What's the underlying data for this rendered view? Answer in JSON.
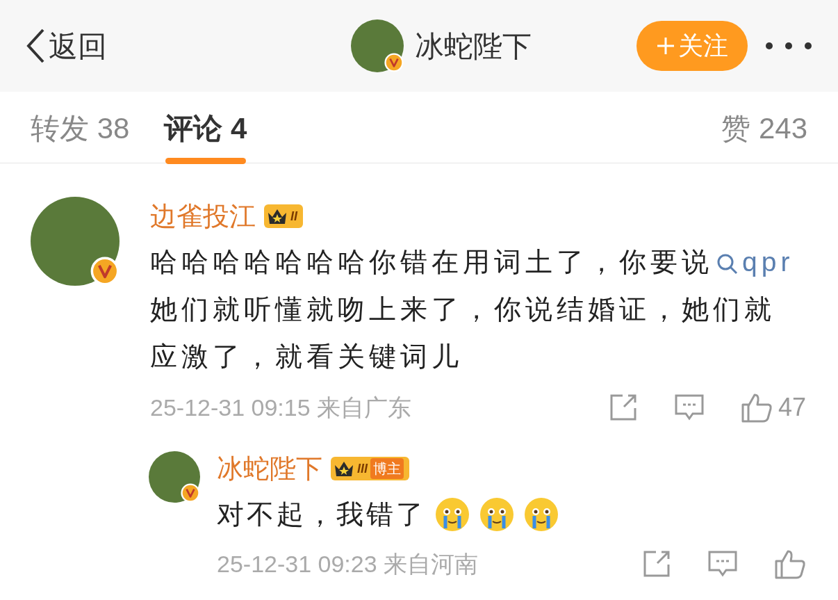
{
  "header": {
    "back_label": "返回",
    "title": "冰蛇陛下",
    "follow_label": "关注"
  },
  "tabs": [
    {
      "label": "转发",
      "count": "38",
      "selected": false
    },
    {
      "label": "评论",
      "count": "4",
      "selected": true
    }
  ],
  "likes": {
    "label": "赞",
    "count": "243"
  },
  "comments": [
    {
      "username": "边雀投江",
      "badge_level": "II",
      "text_before": "哈哈哈哈哈哈哈你错在用词土了，你要说",
      "link": "qpr",
      "text_after": "她们就听懂就吻上来了，你说结婚证，她们就应激了，就看关键词儿",
      "time": "25-12-31 09:15",
      "location": "来自广东",
      "like_count": "47",
      "replies": [
        {
          "username": "冰蛇陛下",
          "badge_level": "III",
          "badge_label": "博主",
          "text": "对不起，我错了",
          "emojis": [
            {
              "kind": "crying"
            },
            {
              "kind": "crying"
            },
            {
              "kind": "crying"
            }
          ],
          "time": "25-12-31 09:23",
          "location": "来自河南"
        }
      ]
    }
  ]
}
